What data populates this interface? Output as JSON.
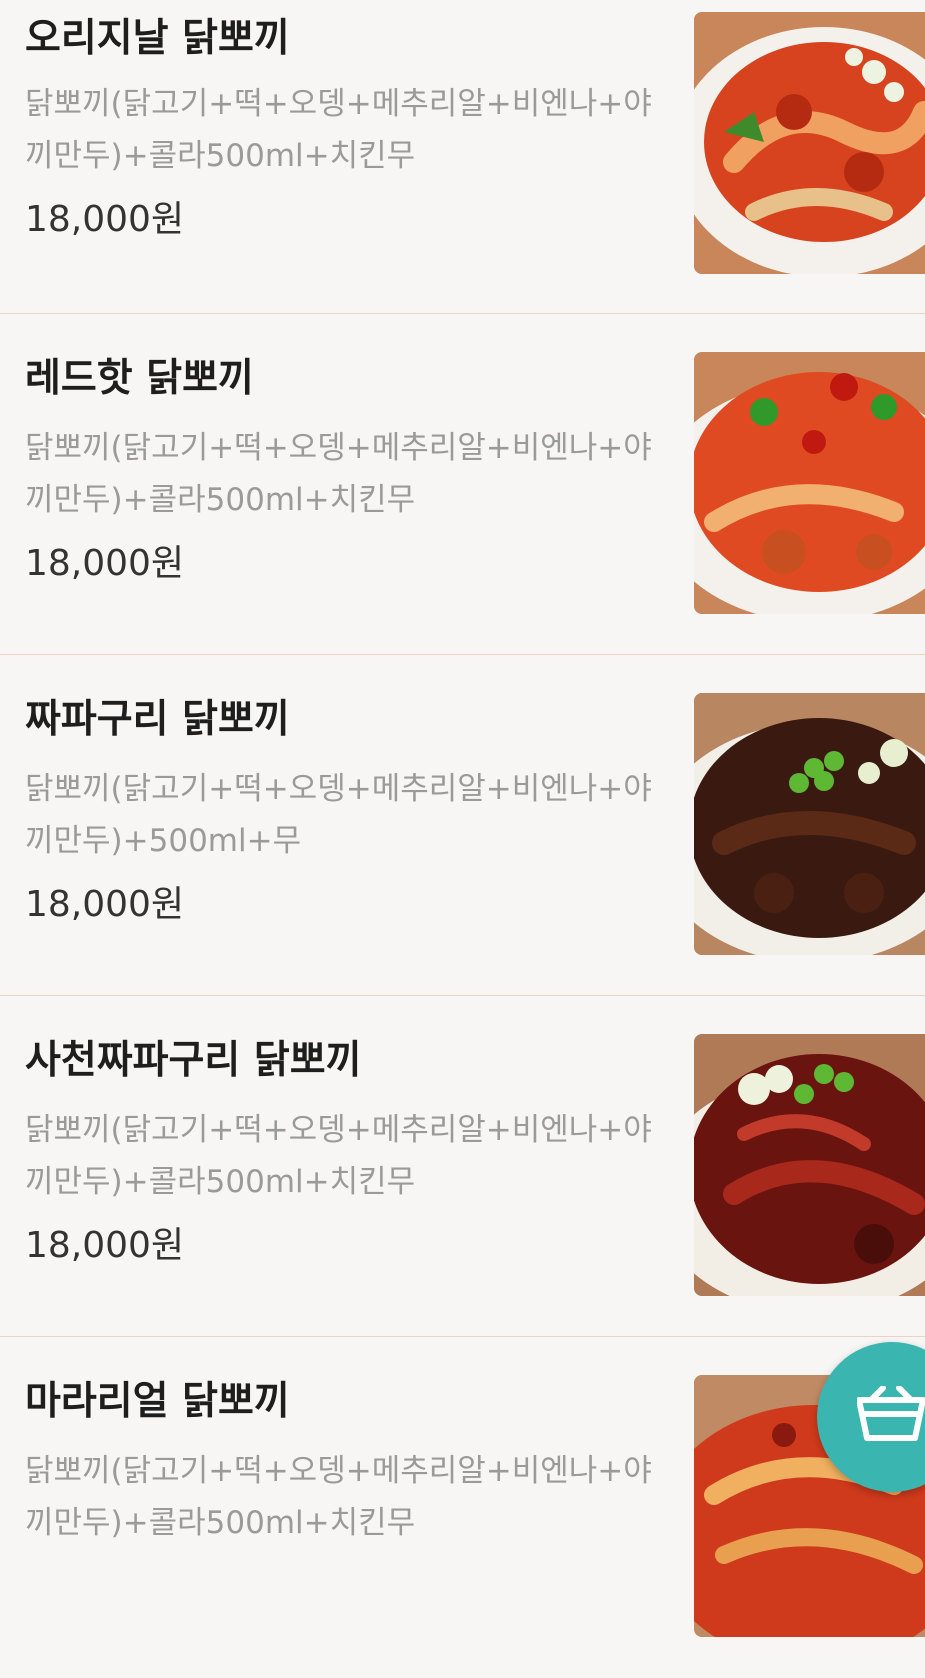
{
  "menu": {
    "items": [
      {
        "name": "오리지날 닭뽀끼",
        "description": "닭뽀끼(닭고기+떡+오뎅+메추리알+비엔나+야끼만두)+콜라500ml+치킨무",
        "price": "18,000원",
        "image_icon": "food-photo"
      },
      {
        "name": "레드핫 닭뽀끼",
        "description": "닭뽀끼(닭고기+떡+오뎅+메추리알+비엔나+야끼만두)+콜라500ml+치킨무",
        "price": "18,000원",
        "image_icon": "food-photo"
      },
      {
        "name": "짜파구리 닭뽀끼",
        "description": "닭뽀끼(닭고기+떡+오뎅+메추리알+비엔나+야끼만두)+500ml+무",
        "price": "18,000원",
        "image_icon": "food-photo"
      },
      {
        "name": "사천짜파구리 닭뽀끼",
        "description": "닭뽀끼(닭고기+떡+오뎅+메추리알+비엔나+야끼만두)+콜라500ml+치킨무",
        "price": "18,000원",
        "image_icon": "food-photo"
      },
      {
        "name": "마라리얼 닭뽀끼",
        "description": "닭뽀끼(닭고기+떡+오뎅+메추리알+비엔나+야끼만두)+콜라500ml+치킨무",
        "price": "",
        "image_icon": "food-photo"
      }
    ]
  },
  "cart_button": {
    "icon": "basket-icon",
    "color": "#3ab5b0"
  },
  "colors": {
    "background": "#f7f6f4",
    "divider": "#ecd2c2",
    "name_text": "#1e1e1e",
    "description_text": "#9a9a9a",
    "price_text": "#333333"
  }
}
